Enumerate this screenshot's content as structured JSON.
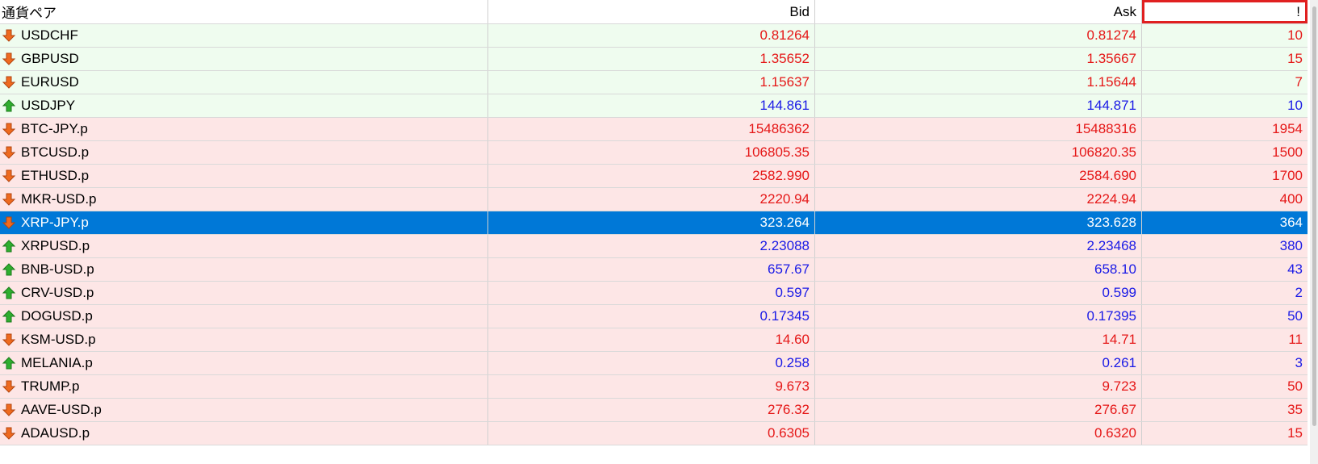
{
  "header": {
    "symbol": "通貨ペア",
    "bid": "Bid",
    "ask": "Ask",
    "spread": "!"
  },
  "colors": {
    "down": "#e51717",
    "up": "#1a1ae6",
    "selected": "#0078d7"
  },
  "rows": [
    {
      "symbol": "USDCHF",
      "bid": "0.81264",
      "ask": "0.81274",
      "spread": "10",
      "dir": "down",
      "bg": "green"
    },
    {
      "symbol": "GBPUSD",
      "bid": "1.35652",
      "ask": "1.35667",
      "spread": "15",
      "dir": "down",
      "bg": "green"
    },
    {
      "symbol": "EURUSD",
      "bid": "1.15637",
      "ask": "1.15644",
      "spread": "7",
      "dir": "down",
      "bg": "green"
    },
    {
      "symbol": "USDJPY",
      "bid": "144.861",
      "ask": "144.871",
      "spread": "10",
      "dir": "up",
      "bg": "green"
    },
    {
      "symbol": "BTC-JPY.p",
      "bid": "15486362",
      "ask": "15488316",
      "spread": "1954",
      "dir": "down",
      "bg": "red"
    },
    {
      "symbol": "BTCUSD.p",
      "bid": "106805.35",
      "ask": "106820.35",
      "spread": "1500",
      "dir": "down",
      "bg": "red"
    },
    {
      "symbol": "ETHUSD.p",
      "bid": "2582.990",
      "ask": "2584.690",
      "spread": "1700",
      "dir": "down",
      "bg": "red"
    },
    {
      "symbol": "MKR-USD.p",
      "bid": "2220.94",
      "ask": "2224.94",
      "spread": "400",
      "dir": "down",
      "bg": "red"
    },
    {
      "symbol": "XRP-JPY.p",
      "bid": "323.264",
      "ask": "323.628",
      "spread": "364",
      "dir": "down",
      "bg": "red",
      "selected": true
    },
    {
      "symbol": "XRPUSD.p",
      "bid": "2.23088",
      "ask": "2.23468",
      "spread": "380",
      "dir": "up",
      "bg": "red"
    },
    {
      "symbol": "BNB-USD.p",
      "bid": "657.67",
      "ask": "658.10",
      "spread": "43",
      "dir": "up",
      "bg": "red"
    },
    {
      "symbol": "CRV-USD.p",
      "bid": "0.597",
      "ask": "0.599",
      "spread": "2",
      "dir": "up",
      "bg": "red"
    },
    {
      "symbol": "DOGUSD.p",
      "bid": "0.17345",
      "ask": "0.17395",
      "spread": "50",
      "dir": "up",
      "bg": "red"
    },
    {
      "symbol": "KSM-USD.p",
      "bid": "14.60",
      "ask": "14.71",
      "spread": "11",
      "dir": "down",
      "bg": "red"
    },
    {
      "symbol": "MELANIA.p",
      "bid": "0.258",
      "ask": "0.261",
      "spread": "3",
      "dir": "up",
      "bg": "red"
    },
    {
      "symbol": "TRUMP.p",
      "bid": "9.673",
      "ask": "9.723",
      "spread": "50",
      "dir": "down",
      "bg": "red"
    },
    {
      "symbol": "AAVE-USD.p",
      "bid": "276.32",
      "ask": "276.67",
      "spread": "35",
      "dir": "down",
      "bg": "red"
    },
    {
      "symbol": "ADAUSD.p",
      "bid": "0.6305",
      "ask": "0.6320",
      "spread": "15",
      "dir": "down",
      "bg": "red"
    }
  ]
}
